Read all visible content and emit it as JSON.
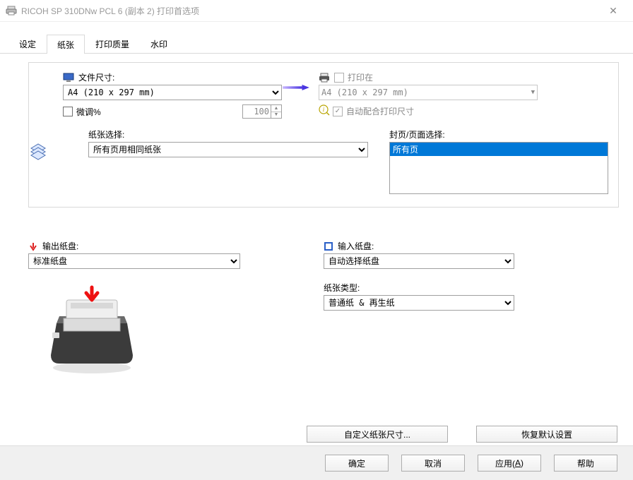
{
  "window": {
    "title": "RICOH SP 310DNw PCL 6 (副本 2) 打印首选项"
  },
  "tabs": [
    {
      "label": "设定"
    },
    {
      "label": "纸张"
    },
    {
      "label": "打印质量"
    },
    {
      "label": "水印"
    }
  ],
  "doc_size": {
    "label": "文件尺寸:",
    "value": "A4 (210 x 297 mm)",
    "fine_adjust_label": "微调%",
    "fine_adjust_value": "100"
  },
  "print_on": {
    "label": "打印在",
    "value": "A4 (210 x 297 mm)",
    "auto_fit_label": "自动配合打印尺寸"
  },
  "paper_select": {
    "label": "纸张选择:",
    "value": "所有页用相同纸张"
  },
  "cover_select": {
    "label": "封页/页面选择:",
    "items": [
      "所有页"
    ]
  },
  "output_tray": {
    "label": "输出纸盘:",
    "value": "标准纸盘"
  },
  "input_tray": {
    "label": "输入纸盘:",
    "value": "自动选择纸盘"
  },
  "paper_type": {
    "label": "纸张类型:",
    "value": "普通纸 & 再生纸"
  },
  "buttons": {
    "custom_size": "自定义纸张尺寸...",
    "restore_defaults": "恢复默认设置",
    "ok": "确定",
    "cancel": "取消",
    "apply_prefix": "应用(",
    "apply_key": "A",
    "apply_suffix": ")",
    "help": "帮助"
  }
}
